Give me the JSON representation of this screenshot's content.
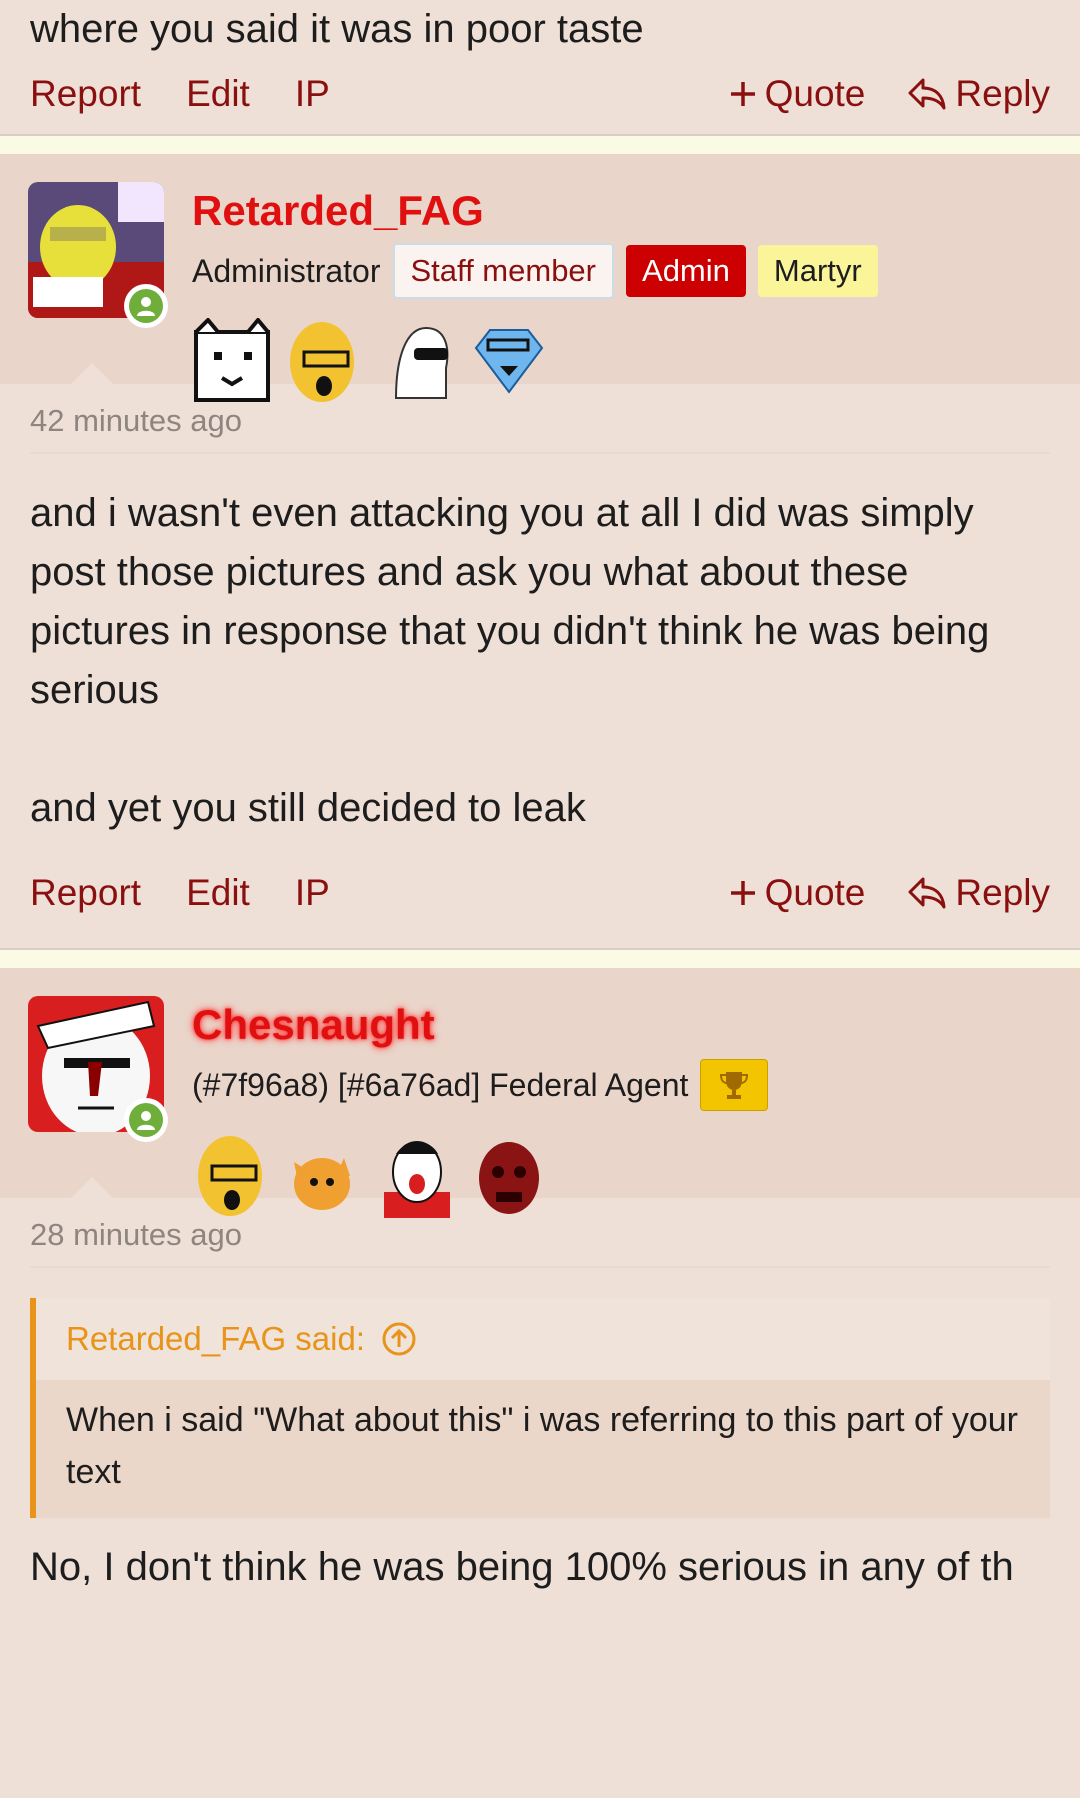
{
  "top_post": {
    "tail_text": "where you said it was in poor taste",
    "actions": {
      "report": "Report",
      "edit": "Edit",
      "ip": "IP",
      "quote": "Quote",
      "reply": "Reply"
    }
  },
  "post1": {
    "username": "Retarded_FAG",
    "user_title": "Administrator",
    "badges": [
      "Staff member",
      "Admin",
      "Martyr"
    ],
    "time": "42 minutes ago",
    "paragraphs": [
      "and i wasn't even attacking you at all I did was simply post those pictures and ask you what about these pictures in response that you didn't think he was being serious",
      "and yet you still decided to leak"
    ],
    "actions": {
      "report": "Report",
      "edit": "Edit",
      "ip": "IP",
      "quote": "Quote",
      "reply": "Reply"
    }
  },
  "post2": {
    "username": "Chesnaught",
    "user_title": "(#7f96a8) [#6a76ad] Federal Agent",
    "trophy_icon": "trophy-icon",
    "time": "28 minutes ago",
    "quote_author": "Retarded_FAG said:",
    "quote_text": "When i said \"What about this\" i was referring to this part of your text",
    "reply_text": "No, I don't think he was being 100% serious in any of th"
  },
  "colors": {
    "link": "#8a1010",
    "username": "#e01010",
    "quote_accent": "#e8941a",
    "online": "#6fae3b"
  }
}
